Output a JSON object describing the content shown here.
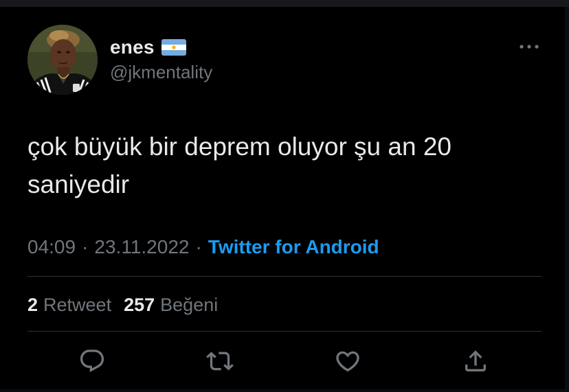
{
  "tweet": {
    "author": {
      "display_name": "enes",
      "handle": "@jkmentality",
      "flag_icon": "argentina-flag-icon"
    },
    "text": "çok büyük bir deprem oluyor şu an 20 saniyedir",
    "meta": {
      "time": "04:09",
      "separator": "·",
      "date": "23.11.2022",
      "source": "Twitter for Android"
    },
    "stats": {
      "retweet_count": "2",
      "retweet_label": "Retweet",
      "like_count": "257",
      "like_label": "Beğeni"
    },
    "actions": [
      {
        "name": "reply",
        "icon": "speech-bubble-icon"
      },
      {
        "name": "retweet",
        "icon": "retweet-arrows-icon"
      },
      {
        "name": "like",
        "icon": "heart-icon"
      },
      {
        "name": "share",
        "icon": "share-upload-icon"
      }
    ],
    "more_icon": "more-horizontal-icon"
  },
  "colors": {
    "background": "#000000",
    "text_primary": "#e7e9ea",
    "text_secondary": "#71767b",
    "accent": "#1d9bf0",
    "divider": "#2f3336",
    "flag_blue": "#74acdf",
    "flag_sun": "#f6b40e"
  }
}
